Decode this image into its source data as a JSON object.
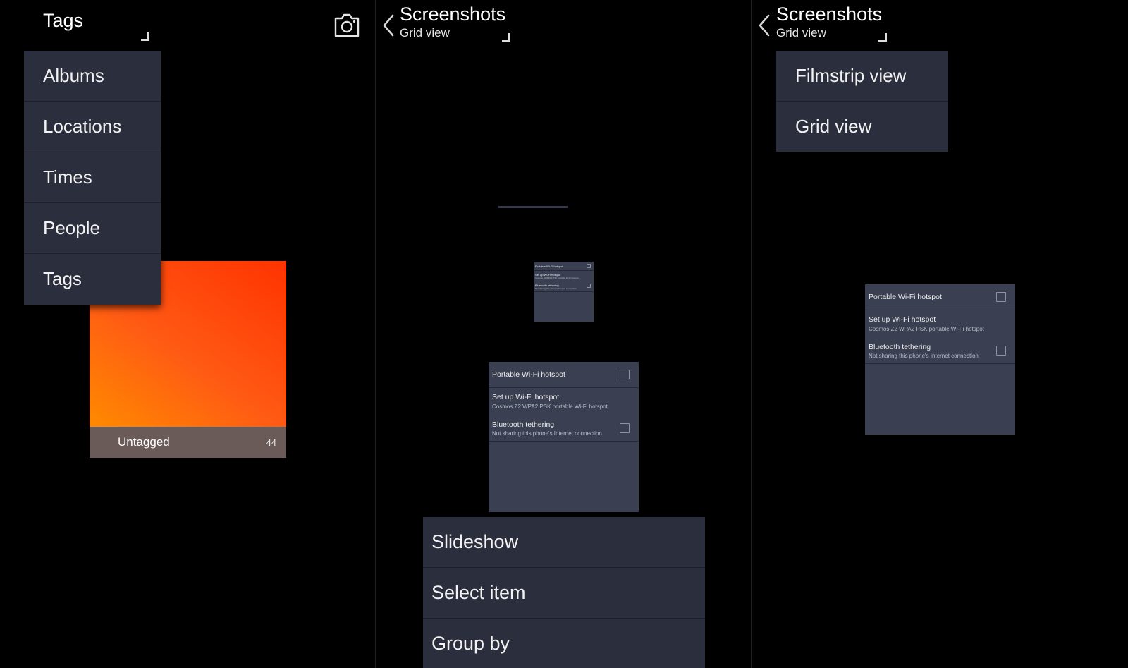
{
  "panel1": {
    "title": "Tags",
    "menu": [
      "Albums",
      "Locations",
      "Times",
      "People",
      "Tags"
    ],
    "tile": {
      "label": "Untagged",
      "count": "44"
    }
  },
  "panel2": {
    "title": "Screenshots",
    "subtitle": "Grid view",
    "menu": [
      "Slideshow",
      "Select item",
      "Group by"
    ]
  },
  "panel3": {
    "title": "Screenshots",
    "subtitle": "Grid view",
    "menu": [
      "Filmstrip view",
      "Grid view"
    ]
  },
  "thumbnail": {
    "row1_title": "Portable Wi-Fi hotspot",
    "row2_title": "Set up Wi-Fi hotspot",
    "row2_sub": "Cosmos Z2 WPA2 PSK portable Wi-Fi hotspot",
    "row3_title": "Bluetooth tethering",
    "row3_sub": "Not sharing this phone's Internet connection"
  },
  "colors": {
    "menu_bg": "#2b2f3d",
    "thumb_bg": "#3a3f51",
    "tile_gradient_start": "#ff8a00",
    "tile_gradient_end": "#ff3300",
    "tile_caption_bg": "#6a5b58"
  },
  "icons": [
    "camera-icon",
    "back-arrow-icon",
    "dropdown-corner-icon",
    "checkbox-icon"
  ]
}
